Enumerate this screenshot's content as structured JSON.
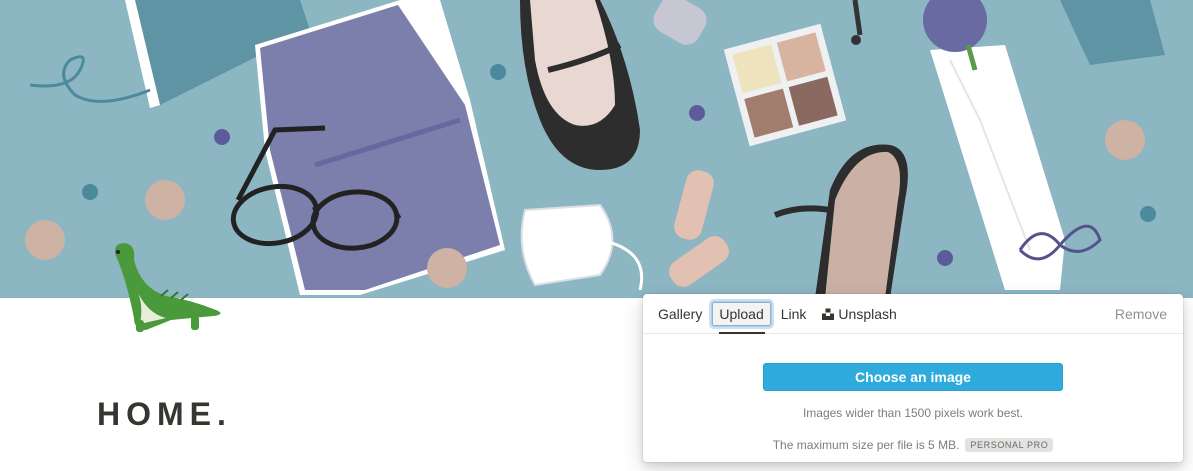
{
  "cover": {
    "background": "#8db6c3",
    "illustration_items": [
      "book-icon",
      "glasses-icon",
      "shoe-icon",
      "eyeshadow-palette-icon",
      "bandage-icon",
      "face-mask-icon",
      "bouquet-icon",
      "candy-icon",
      "cookie-icon",
      "lipstick-icon"
    ]
  },
  "page": {
    "icon": "dinosaur-icon",
    "title": "HOME."
  },
  "cover_menu": {
    "tabs": [
      {
        "label": "Gallery",
        "active": false
      },
      {
        "label": "Upload",
        "active": true
      },
      {
        "label": "Link",
        "active": false
      },
      {
        "label": "Unsplash",
        "active": false,
        "icon": "unsplash-icon"
      }
    ],
    "remove_label": "Remove",
    "upload": {
      "button_label": "Choose an image",
      "hint": "Images wider than 1500 pixels work best.",
      "size_hint": "The maximum size per file is 5 MB.",
      "plan_badge": "PERSONAL PRO"
    },
    "accent": "#2eaadc"
  }
}
